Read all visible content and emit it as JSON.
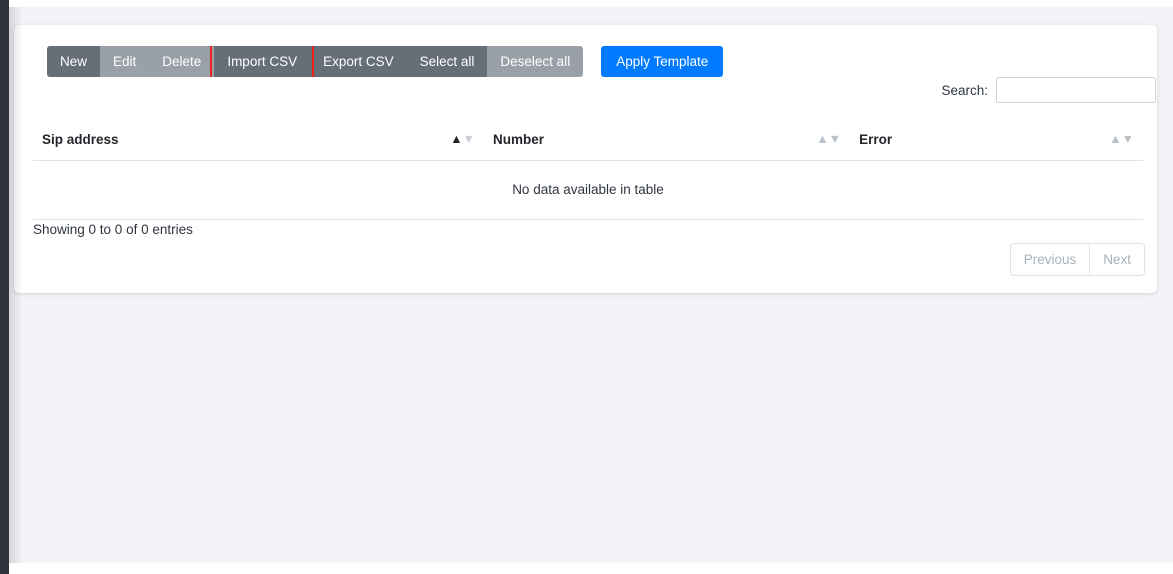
{
  "toolbar": {
    "buttons": [
      {
        "label": "New",
        "style": "dark"
      },
      {
        "label": "Edit",
        "style": "light"
      },
      {
        "label": "Delete",
        "style": "light"
      },
      {
        "label": "Import CSV",
        "style": "dark",
        "highlighted": true
      },
      {
        "label": "Export CSV",
        "style": "dark"
      },
      {
        "label": "Select all",
        "style": "dark"
      },
      {
        "label": "Deselect all",
        "style": "light"
      }
    ],
    "apply_template_label": "Apply Template",
    "highlight_color": "#ef2020",
    "primary_color": "#007bff"
  },
  "search": {
    "label": "Search:",
    "value": "",
    "placeholder": ""
  },
  "table": {
    "columns": [
      {
        "label": "Sip address",
        "sort": "ascending",
        "sort_icon": "sort-asc-icon"
      },
      {
        "label": "Number",
        "sort": "none",
        "sort_icon": "sort-none-icon"
      },
      {
        "label": "Error",
        "sort": "none",
        "sort_icon": "sort-none-icon"
      }
    ],
    "empty_message": "No data available in table",
    "rows": []
  },
  "footer": {
    "info": "Showing 0 to 0 of 0 entries",
    "previous_label": "Previous",
    "next_label": "Next"
  }
}
